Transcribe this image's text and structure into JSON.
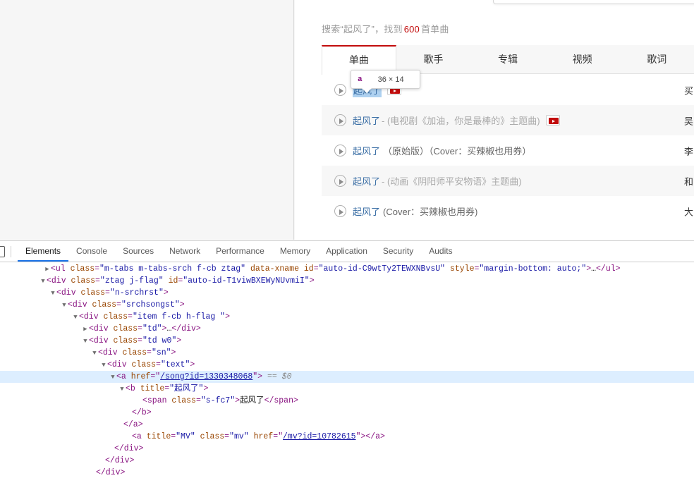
{
  "page": {
    "search_summary": {
      "prefix": "搜索",
      "quote_open": "“",
      "keyword": "起风了",
      "quote_close": "”",
      "middle": "，找到",
      "count": "600",
      "suffix": "首单曲"
    },
    "tabs": [
      {
        "label": "单曲",
        "active": true
      },
      {
        "label": "歌手",
        "active": false
      },
      {
        "label": "专辑",
        "active": false
      },
      {
        "label": "视频",
        "active": false
      },
      {
        "label": "歌词",
        "active": false
      }
    ],
    "results": [
      {
        "title": "起风了",
        "subtitle": "",
        "subtitle_dark": "",
        "has_mv": true,
        "highlight": true,
        "artist": "买"
      },
      {
        "title": "起风了",
        "subtitle": "- (电视剧《加油，你是最棒的》主题曲)",
        "subtitle_dark": "",
        "has_mv": true,
        "highlight": false,
        "artist": "吴"
      },
      {
        "title": "起风了",
        "subtitle": "",
        "subtitle_dark": "（原始版）（Cover：买辣椒也用券）",
        "has_mv": false,
        "highlight": false,
        "artist": "李"
      },
      {
        "title": "起风了",
        "subtitle": "- (动画《阴阳师平安物语》主题曲)",
        "subtitle_dark": "",
        "has_mv": false,
        "highlight": false,
        "artist": "和"
      },
      {
        "title": "起风了",
        "subtitle": "",
        "subtitle_dark": "(Cover：买辣椒也用券)",
        "has_mv": false,
        "highlight": false,
        "artist": "大"
      }
    ],
    "inspect_tooltip": {
      "tag": "a",
      "dimensions": "36 × 14"
    }
  },
  "devtools": {
    "tabs": [
      {
        "label": "Elements",
        "active": true
      },
      {
        "label": "Console",
        "active": false
      },
      {
        "label": "Sources",
        "active": false
      },
      {
        "label": "Network",
        "active": false
      },
      {
        "label": "Performance",
        "active": false
      },
      {
        "label": "Memory",
        "active": false
      },
      {
        "label": "Application",
        "active": false
      },
      {
        "label": "Security",
        "active": false
      },
      {
        "label": "Audits",
        "active": false
      }
    ],
    "dom_lines": [
      {
        "indent": 62,
        "arrow": "closed",
        "selected": false,
        "parts": [
          {
            "t": "pu",
            "v": "<ul "
          },
          {
            "t": "an",
            "v": "class"
          },
          {
            "t": "pu",
            "v": "="
          },
          {
            "t": "av",
            "v": "\"m-tabs m-tabs-srch f-cb ztag\""
          },
          {
            "t": "pu",
            "v": " "
          },
          {
            "t": "an",
            "v": "data-xname"
          },
          {
            "t": "pu",
            "v": " "
          },
          {
            "t": "an",
            "v": "id"
          },
          {
            "t": "pu",
            "v": "="
          },
          {
            "t": "av",
            "v": "\"auto-id-C9wtTy2TEWXNBvsU\""
          },
          {
            "t": "pu",
            "v": " "
          },
          {
            "t": "an",
            "v": "style"
          },
          {
            "t": "pu",
            "v": "="
          },
          {
            "t": "av",
            "v": "\"margin-bottom: auto;\""
          },
          {
            "t": "pu",
            "v": ">"
          },
          {
            "t": "tx",
            "v": "…"
          },
          {
            "t": "pu",
            "v": "</ul>"
          }
        ]
      },
      {
        "indent": 56,
        "arrow": "open",
        "selected": false,
        "parts": [
          {
            "t": "pu",
            "v": "<div "
          },
          {
            "t": "an",
            "v": "class"
          },
          {
            "t": "pu",
            "v": "="
          },
          {
            "t": "av",
            "v": "\"ztag j-flag\""
          },
          {
            "t": "pu",
            "v": " "
          },
          {
            "t": "an",
            "v": "id"
          },
          {
            "t": "pu",
            "v": "="
          },
          {
            "t": "av",
            "v": "\"auto-id-T1viwBXEWyNUvmiI\""
          },
          {
            "t": "pu",
            "v": ">"
          }
        ]
      },
      {
        "indent": 70,
        "arrow": "open",
        "selected": false,
        "parts": [
          {
            "t": "pu",
            "v": "<div "
          },
          {
            "t": "an",
            "v": "class"
          },
          {
            "t": "pu",
            "v": "="
          },
          {
            "t": "av",
            "v": "\"n-srchrst\""
          },
          {
            "t": "pu",
            "v": ">"
          }
        ]
      },
      {
        "indent": 86,
        "arrow": "open",
        "selected": false,
        "parts": [
          {
            "t": "pu",
            "v": "<div "
          },
          {
            "t": "an",
            "v": "class"
          },
          {
            "t": "pu",
            "v": "="
          },
          {
            "t": "av",
            "v": "\"srchsongst\""
          },
          {
            "t": "pu",
            "v": ">"
          }
        ]
      },
      {
        "indent": 102,
        "arrow": "open",
        "selected": false,
        "parts": [
          {
            "t": "pu",
            "v": "<div "
          },
          {
            "t": "an",
            "v": "class"
          },
          {
            "t": "pu",
            "v": "="
          },
          {
            "t": "av",
            "v": "\"item f-cb h-flag  \""
          },
          {
            "t": "pu",
            "v": ">"
          }
        ]
      },
      {
        "indent": 116,
        "arrow": "closed",
        "selected": false,
        "parts": [
          {
            "t": "pu",
            "v": "<div "
          },
          {
            "t": "an",
            "v": "class"
          },
          {
            "t": "pu",
            "v": "="
          },
          {
            "t": "av",
            "v": "\"td\""
          },
          {
            "t": "pu",
            "v": ">"
          },
          {
            "t": "tx",
            "v": "…"
          },
          {
            "t": "pu",
            "v": "</div>"
          }
        ]
      },
      {
        "indent": 116,
        "arrow": "open",
        "selected": false,
        "parts": [
          {
            "t": "pu",
            "v": "<div "
          },
          {
            "t": "an",
            "v": "class"
          },
          {
            "t": "pu",
            "v": "="
          },
          {
            "t": "av",
            "v": "\"td w0\""
          },
          {
            "t": "pu",
            "v": ">"
          }
        ]
      },
      {
        "indent": 129,
        "arrow": "open",
        "selected": false,
        "parts": [
          {
            "t": "pu",
            "v": "<div "
          },
          {
            "t": "an",
            "v": "class"
          },
          {
            "t": "pu",
            "v": "="
          },
          {
            "t": "av",
            "v": "\"sn\""
          },
          {
            "t": "pu",
            "v": ">"
          }
        ]
      },
      {
        "indent": 142,
        "arrow": "open",
        "selected": false,
        "parts": [
          {
            "t": "pu",
            "v": "<div "
          },
          {
            "t": "an",
            "v": "class"
          },
          {
            "t": "pu",
            "v": "="
          },
          {
            "t": "av",
            "v": "\"text\""
          },
          {
            "t": "pu",
            "v": ">"
          }
        ]
      },
      {
        "indent": 155,
        "arrow": "open",
        "selected": true,
        "parts": [
          {
            "t": "pu",
            "v": "<a "
          },
          {
            "t": "an",
            "v": "href"
          },
          {
            "t": "pu",
            "v": "="
          },
          {
            "t": "pu",
            "v": "\""
          },
          {
            "t": "lk",
            "v": "/song?id=1330348068"
          },
          {
            "t": "pu",
            "v": "\""
          },
          {
            "t": "pu",
            "v": ">"
          },
          {
            "t": "sel-marker",
            "v": "  == $0"
          }
        ]
      },
      {
        "indent": 168,
        "arrow": "open",
        "selected": false,
        "parts": [
          {
            "t": "pu",
            "v": "<b "
          },
          {
            "t": "an",
            "v": "title"
          },
          {
            "t": "pu",
            "v": "="
          },
          {
            "t": "av",
            "v": "\"起风了\""
          },
          {
            "t": "pu",
            "v": ">"
          }
        ]
      },
      {
        "indent": 192,
        "arrow": "none",
        "selected": false,
        "parts": [
          {
            "t": "pu",
            "v": "<span "
          },
          {
            "t": "an",
            "v": "class"
          },
          {
            "t": "pu",
            "v": "="
          },
          {
            "t": "av",
            "v": "\"s-fc7\""
          },
          {
            "t": "pu",
            "v": ">"
          },
          {
            "t": "tx",
            "v": "起风了"
          },
          {
            "t": "pu",
            "v": "</span>"
          }
        ]
      },
      {
        "indent": 177,
        "arrow": "none",
        "selected": false,
        "parts": [
          {
            "t": "pu",
            "v": "</b>"
          }
        ]
      },
      {
        "indent": 165,
        "arrow": "none",
        "selected": false,
        "parts": [
          {
            "t": "pu",
            "v": "</a>"
          }
        ]
      },
      {
        "indent": 177,
        "arrow": "none",
        "selected": false,
        "parts": [
          {
            "t": "pu",
            "v": "<a "
          },
          {
            "t": "an",
            "v": "title"
          },
          {
            "t": "pu",
            "v": "="
          },
          {
            "t": "av",
            "v": "\"MV\""
          },
          {
            "t": "pu",
            "v": " "
          },
          {
            "t": "an",
            "v": "class"
          },
          {
            "t": "pu",
            "v": "="
          },
          {
            "t": "av",
            "v": "\"mv\""
          },
          {
            "t": "pu",
            "v": " "
          },
          {
            "t": "an",
            "v": "href"
          },
          {
            "t": "pu",
            "v": "="
          },
          {
            "t": "pu",
            "v": "\""
          },
          {
            "t": "lk",
            "v": "/mv?id=10782615"
          },
          {
            "t": "pu",
            "v": "\""
          },
          {
            "t": "pu",
            "v": "></a>"
          }
        ]
      },
      {
        "indent": 152,
        "arrow": "none",
        "selected": false,
        "parts": [
          {
            "t": "pu",
            "v": "</div>"
          }
        ]
      },
      {
        "indent": 139,
        "arrow": "none",
        "selected": false,
        "parts": [
          {
            "t": "pu",
            "v": "</div>"
          }
        ]
      },
      {
        "indent": 126,
        "arrow": "none",
        "selected": false,
        "parts": [
          {
            "t": "pu",
            "v": "</div>"
          }
        ]
      }
    ]
  }
}
